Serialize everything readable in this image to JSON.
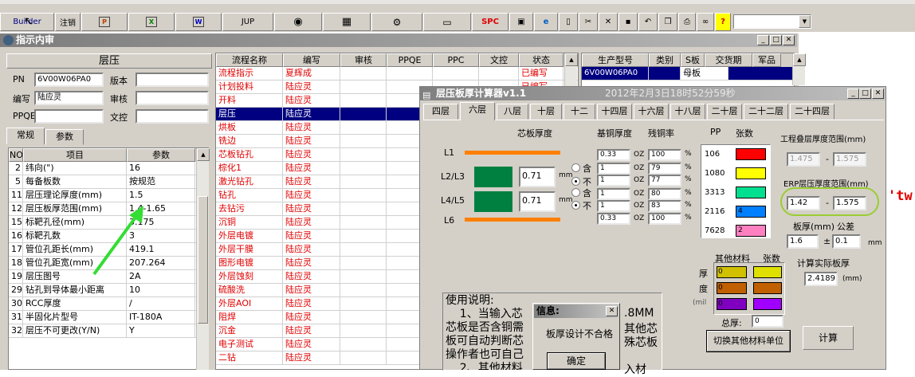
{
  "toolbar": {
    "builder": "Builder",
    "logout": "注销",
    "jup": "JUP",
    "spc": "SPC"
  },
  "main_window": {
    "title": "指示内审",
    "section_title": "层压",
    "pn_label": "PN",
    "pn_value": "6V00W06PA0",
    "version_label": "版本",
    "version_value": "",
    "writer_label": "编写",
    "writer_value": "陆应灵",
    "review_label": "审核",
    "review_value": "",
    "ppqe_label": "PPQE",
    "ppqe_value": "",
    "wenkong_label": "文控",
    "wenkong_value": "",
    "tabs": [
      "常规",
      "参数"
    ],
    "param_headers": [
      "NO",
      "项目",
      "参数"
    ],
    "params": [
      {
        "no": "2",
        "item": "纬向(\")",
        "value": "16"
      },
      {
        "no": "5",
        "item": "每备板数",
        "value": "按规范"
      },
      {
        "no": "11",
        "item": "层压理论厚度(mm)",
        "value": "1.5"
      },
      {
        "no": "12",
        "item": "层压板厚范围(mm)",
        "value": "1.4-1.65"
      },
      {
        "no": "15",
        "item": "标靶孔径(mm)",
        "value": "3.175"
      },
      {
        "no": "16",
        "item": "标靶孔数",
        "value": "3"
      },
      {
        "no": "17",
        "item": "管位孔距长(mm)",
        "value": "419.1"
      },
      {
        "no": "18",
        "item": "管位孔距宽(mm)",
        "value": "207.264"
      },
      {
        "no": "19",
        "item": "层压图号",
        "value": "2A"
      },
      {
        "no": "29",
        "item": "钻孔到导体最小距离",
        "value": "10"
      },
      {
        "no": "30",
        "item": "RCC厚度",
        "value": "/"
      },
      {
        "no": "31",
        "item": "半固化片型号",
        "value": "IT-180A"
      },
      {
        "no": "32",
        "item": "层压不可更改(Y/N)",
        "value": "Y"
      }
    ],
    "flow_headers": [
      "流程名称",
      "编写",
      "审核",
      "PPQE",
      "PPC",
      "文控",
      "状态"
    ],
    "flow_rows": [
      {
        "name": "流程指示",
        "writer": "夏辉成",
        "status": "已编写"
      },
      {
        "name": "计划投料",
        "writer": "陆应灵",
        "status": "已编写"
      },
      {
        "name": "开料",
        "writer": "陆应灵",
        "status": ""
      },
      {
        "name": "层压",
        "writer": "陆应灵",
        "status": ""
      },
      {
        "name": "烘板",
        "writer": "陆应灵",
        "status": ""
      },
      {
        "name": "铣边",
        "writer": "陆应灵",
        "status": ""
      },
      {
        "name": "芯板钻孔",
        "writer": "陆应灵",
        "status": ""
      },
      {
        "name": "棕化1",
        "writer": "陆应灵",
        "status": ""
      },
      {
        "name": "激光钻孔",
        "writer": "陆应灵",
        "status": ""
      },
      {
        "name": "钻孔",
        "writer": "陆应灵",
        "status": ""
      },
      {
        "name": "去钻污",
        "writer": "陆应灵",
        "status": ""
      },
      {
        "name": "沉铜",
        "writer": "陆应灵",
        "status": ""
      },
      {
        "name": "外层电镀",
        "writer": "陆应灵",
        "status": ""
      },
      {
        "name": "外层干膜",
        "writer": "陆应灵",
        "status": ""
      },
      {
        "name": "图形电镀",
        "writer": "陆应灵",
        "status": ""
      },
      {
        "name": "外层蚀刻",
        "writer": "陆应灵",
        "status": ""
      },
      {
        "name": "硫酸洗",
        "writer": "陆应灵",
        "status": ""
      },
      {
        "name": "外层AOI",
        "writer": "陆应灵",
        "status": ""
      },
      {
        "name": "阻焊",
        "writer": "陆应灵",
        "status": ""
      },
      {
        "name": "沉金",
        "writer": "陆应灵",
        "status": ""
      },
      {
        "name": "电子测试",
        "writer": "陆应灵",
        "status": ""
      },
      {
        "name": "二钻",
        "writer": "陆应灵",
        "status": ""
      }
    ],
    "prod_headers": [
      "生产型号",
      "类别",
      "S板",
      "交货期",
      "军品"
    ],
    "prod_row": {
      "model": "6V00W06PA0",
      "type": "",
      "s": "母板",
      "date": "",
      "mil": ""
    }
  },
  "calc": {
    "title": "层压板厚计算器v1.1",
    "datetime": "2012年2月3日18时52分59秒",
    "tabs": [
      "四层",
      "六层",
      "八层",
      "十层",
      "十二",
      "十四层",
      "十六层",
      "十八层",
      "二十层",
      "二十二层",
      "二十四层"
    ],
    "core_thk_label": "芯板厚度",
    "base_cu_label": "基铜厚度",
    "residual_label": "残铜率",
    "pp_label": "PP",
    "count_label": "张数",
    "layer_labels": [
      "L1",
      "L2/L3",
      "L4/L5",
      "L6"
    ],
    "core_values": [
      "0.71",
      "0.71"
    ],
    "mm": "mm",
    "radio_yes": "含",
    "radio_no": "不",
    "cu_values": [
      "0.33",
      "1",
      "1",
      "1",
      "1",
      "0.33"
    ],
    "oz": "OZ",
    "residual_values": [
      "100",
      "79",
      "77",
      "80",
      "83",
      "100"
    ],
    "pct": "%",
    "pp_rows": [
      {
        "type": "106",
        "count": "",
        "color": "#ff0000"
      },
      {
        "type": "1080",
        "count": "",
        "color": "#ffff00"
      },
      {
        "type": "3313",
        "count": "",
        "color": "#00e090"
      },
      {
        "type": "2116",
        "count": "4",
        "color": "#0080ff"
      },
      {
        "type": "7628",
        "count": "2",
        "color": "#ff80c0"
      }
    ],
    "eng_range_label": "工程叠层厚度范围(mm)",
    "eng_min": "1.475",
    "eng_max": "1.575",
    "dash": "-",
    "erp_range_label": "ERP层压厚度范围(mm)",
    "erp_min": "1.42",
    "erp_max": "1.575",
    "thickness_label": "板厚(mm)",
    "tol_label": "公差",
    "thickness": "1.6",
    "pm": "±",
    "tol": "0.1",
    "mm2": "mm",
    "actual_label": "计算实际板厚",
    "actual_value": "2.4189",
    "actual_unit": "(mm)",
    "other_label": "其他材料",
    "other_count_label": "张数",
    "thick_side": "厚",
    "du_side": "度",
    "mil_side": "(mil",
    "other_values": [
      "0",
      "0",
      "0"
    ],
    "total_label": "总厚:",
    "total_value": "0",
    "switch_btn": "切换其他材料单位",
    "calc_btn": "计算",
    "usage_title": "使用说明:",
    "usage_lines": [
      "    1、当输入芯",
      "芯板是否含铜需",
      "板可自动判断芯",
      "操作者也可自己",
      "    2、其他材料"
    ],
    "usage_right": [
      ".8MM",
      "其他芯",
      "殊芯板",
      "",
      "入材"
    ]
  },
  "dialog": {
    "title": "信息:",
    "message": "板厚设计不合格",
    "ok": "确定"
  },
  "side_text": "'tw"
}
